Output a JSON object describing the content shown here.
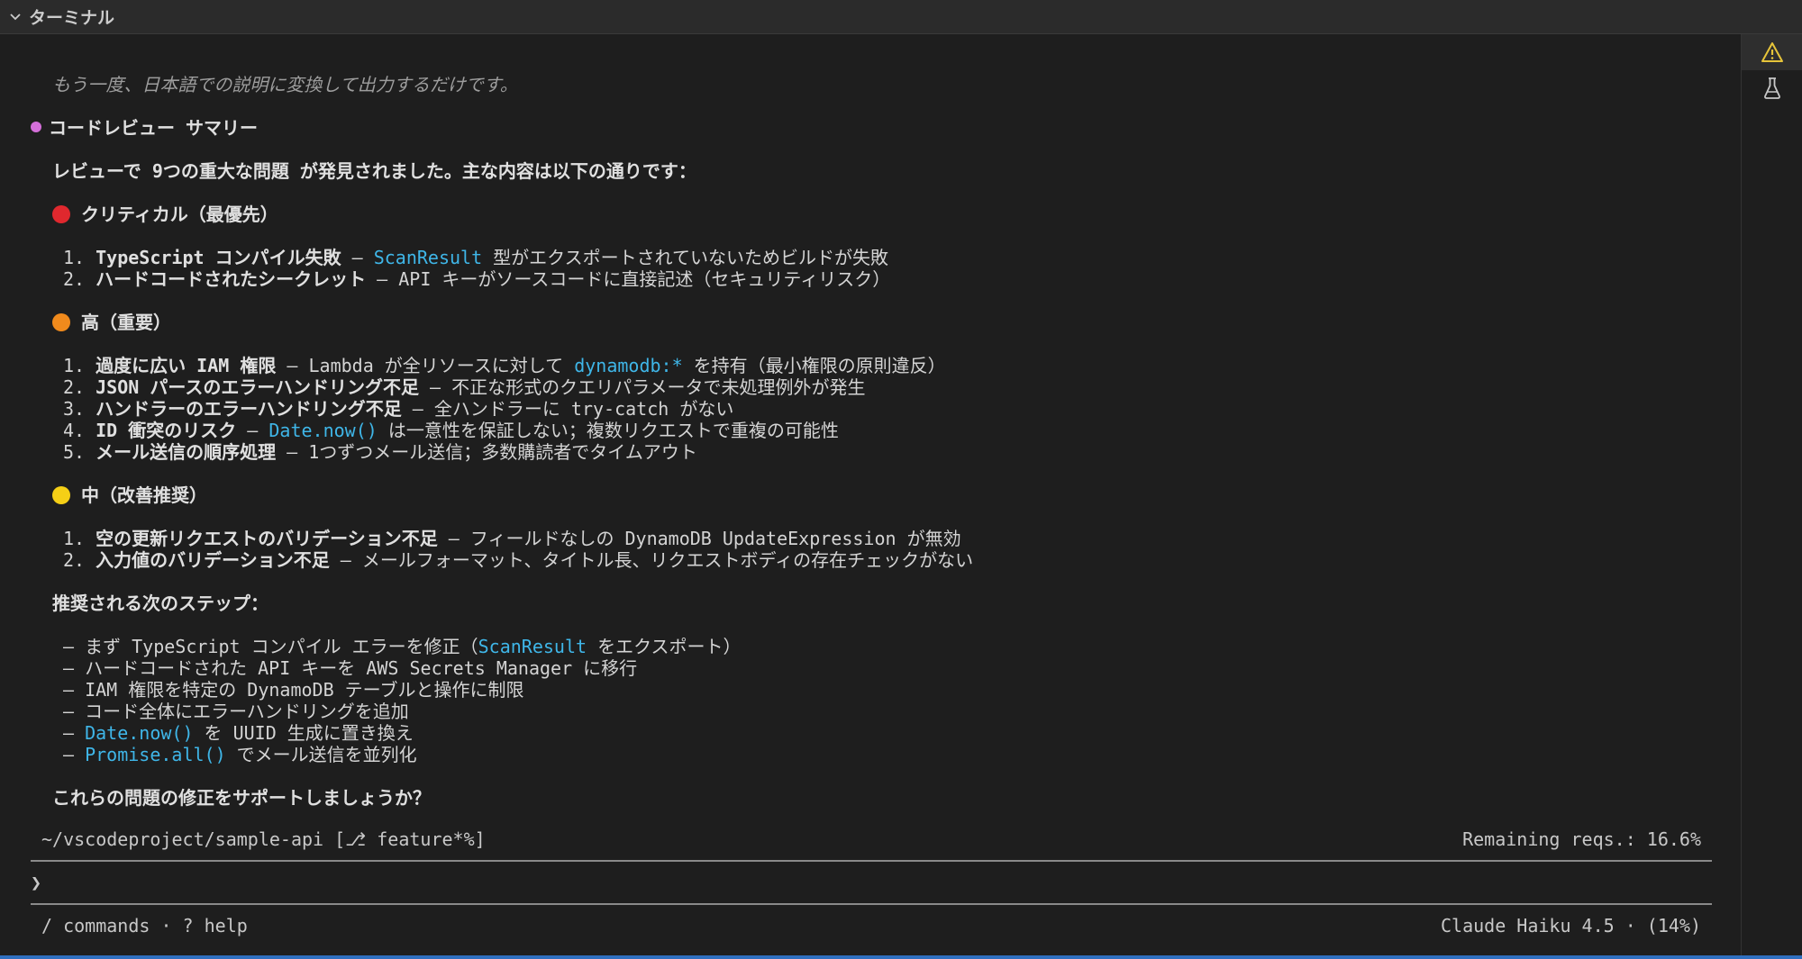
{
  "header": {
    "title": "ターミナル"
  },
  "icons": {
    "warning": "warning-icon",
    "flask": "flask-icon"
  },
  "body": {
    "intro": "もう一度、日本語での説明に変換して出力するだけです。",
    "summary_title": "コードレビュー サマリー",
    "lead_pre": "レビューで ",
    "lead_bold": "9つの重大な問題",
    "lead_post": " が発見されました。主な内容は以下の通りです：",
    "critical": {
      "heading": "クリティカル（最優先）",
      "items": [
        {
          "num": "1.",
          "bold": "TypeScript コンパイル失敗",
          "sep": " – ",
          "code": "ScanResult",
          "rest": " 型がエクスポートされていないためビルドが失敗"
        },
        {
          "num": "2.",
          "bold": "ハードコードされたシークレット",
          "sep": " – ",
          "rest": "API キーがソースコードに直接記述（セキュリティリスク）"
        }
      ]
    },
    "high": {
      "heading": "高（重要）",
      "items": [
        {
          "num": "1.",
          "bold": "過度に広い IAM 権限",
          "sep": " – ",
          "pre": "Lambda が全リソースに対して ",
          "code": "dynamodb:*",
          "rest": " を持有（最小権限の原則違反）"
        },
        {
          "num": "2.",
          "bold": "JSON パースのエラーハンドリング不足",
          "sep": " – ",
          "rest": "不正な形式のクエリパラメータで未処理例外が発生"
        },
        {
          "num": "3.",
          "bold": "ハンドラーのエラーハンドリング不足",
          "sep": " – ",
          "rest": "全ハンドラーに try-catch がない"
        },
        {
          "num": "4.",
          "bold": "ID 衝突のリスク",
          "sep": " – ",
          "code": "Date.now()",
          "rest": " は一意性を保証しない；複数リクエストで重複の可能性"
        },
        {
          "num": "5.",
          "bold": "メール送信の順序処理",
          "sep": " – ",
          "rest": "1つずつメール送信；多数購読者でタイムアウト"
        }
      ]
    },
    "medium": {
      "heading": "中（改善推奨）",
      "items": [
        {
          "num": "1.",
          "bold": "空の更新リクエストのバリデーション不足",
          "sep": " – ",
          "rest": "フィールドなしの DynamoDB UpdateExpression が無効"
        },
        {
          "num": "2.",
          "bold": "入力値のバリデーション不足",
          "sep": " – ",
          "rest": "メールフォーマット、タイトル長、リクエストボディの存在チェックがない"
        }
      ]
    },
    "next_heading": "推奨される次のステップ：",
    "steps": [
      {
        "pre": "まず TypeScript コンパイル エラーを修正（",
        "code": "ScanResult",
        "post": " をエクスポート）"
      },
      {
        "pre": "ハードコードされた API キーを AWS Secrets Manager に移行"
      },
      {
        "pre": "IAM 権限を特定の DynamoDB テーブルと操作に制限"
      },
      {
        "pre": "コード全体にエラーハンドリングを追加"
      },
      {
        "code": "Date.now()",
        "post": " を UUID 生成に置き換え"
      },
      {
        "code": "Promise.all()",
        "post": " でメール送信を並列化"
      }
    ],
    "closing": "これらの問題の修正をサポートしましょうか？"
  },
  "status": {
    "path": "~/vscodeproject/sample-api [⎇ feature*%]",
    "remaining": "Remaining reqs.: 16.6%"
  },
  "input": {
    "prompt": "❯",
    "value": ""
  },
  "footer": {
    "left": "/ commands · ? help",
    "right": "Claude Haiku 4.5 · (14%)"
  },
  "colors": {
    "critical": "#e0282e",
    "high": "#f08a1c",
    "medium": "#f5cf16",
    "bullet": "#d46fd9",
    "code": "#3fb6e8"
  }
}
